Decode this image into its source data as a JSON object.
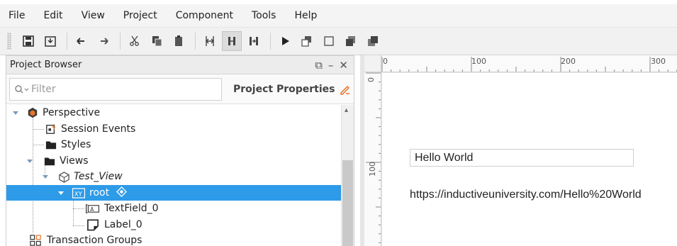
{
  "menu": [
    "File",
    "Edit",
    "View",
    "Project",
    "Component",
    "Tools",
    "Help"
  ],
  "toolbar": {
    "buttons": [
      "save-icon",
      "save-all-icon",
      "undo-icon",
      "redo-icon",
      "cut-icon",
      "copy-icon",
      "paste-icon",
      "align-horizontal-icon",
      "align-vertical-icon",
      "distribute-icon",
      "play-icon",
      "bring-forward-icon",
      "send-backward-icon",
      "bring-to-front-icon",
      "send-to-back-icon"
    ]
  },
  "project_browser": {
    "title": "Project Browser",
    "filter_placeholder": "Filter",
    "properties_label": "Project Properties",
    "tree": [
      {
        "label": "Perspective",
        "icon": "perspective-icon",
        "italic": false
      },
      {
        "label": "Session Events",
        "icon": "session-events-icon",
        "italic": false
      },
      {
        "label": "Styles",
        "icon": "folder-icon",
        "italic": false
      },
      {
        "label": "Views",
        "icon": "folder-icon",
        "italic": false
      },
      {
        "label": "Test_View",
        "icon": "view-icon",
        "italic": true
      },
      {
        "label": "root",
        "icon": "xy-container-icon",
        "italic": false,
        "selected": true
      },
      {
        "label": "TextField_0",
        "icon": "textfield-icon",
        "italic": false
      },
      {
        "label": "Label_0",
        "icon": "label-icon",
        "italic": false
      },
      {
        "label": "Transaction Groups",
        "icon": "transaction-groups-icon",
        "italic": false
      }
    ]
  },
  "ruler": {
    "horizontal": [
      "0",
      "100",
      "200",
      "300"
    ],
    "vertical": [
      "0",
      "100"
    ]
  },
  "canvas": {
    "textfield_value": "Hello World",
    "label_text": "https://inductiveuniversity.com/Hello%20World"
  },
  "colors": {
    "selection": "#2e9be8",
    "folder": "#2b2b2b",
    "perspective_accent": "#e8742a"
  }
}
